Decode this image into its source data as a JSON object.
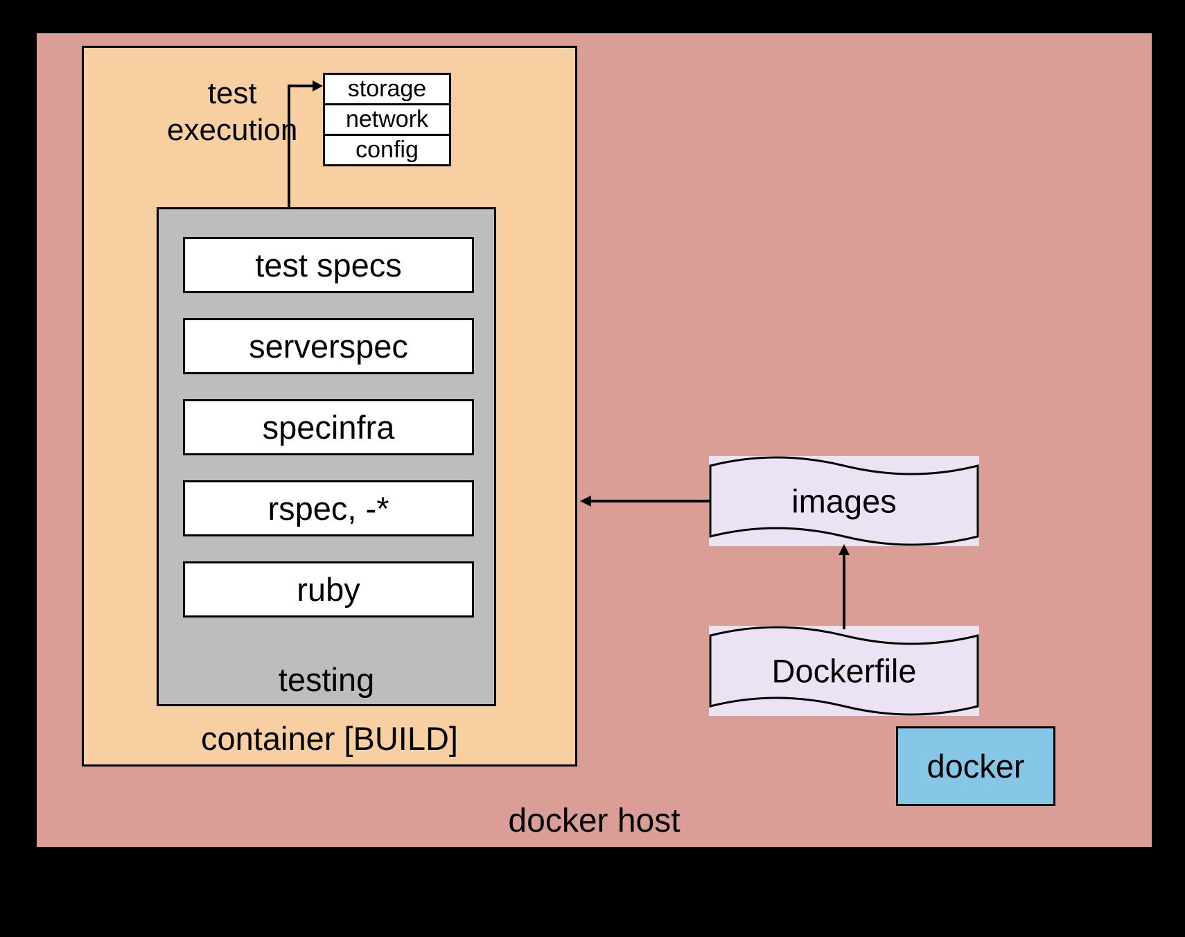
{
  "docker_host": {
    "label": "docker host"
  },
  "container_build": {
    "label": "container [BUILD]"
  },
  "test_execution": {
    "label": "test\nexecution"
  },
  "small_stack": [
    "storage",
    "network",
    "config"
  ],
  "testing": {
    "label": "testing",
    "stack": [
      "test specs",
      "serverspec",
      "specinfra",
      "rspec, -*",
      "ruby"
    ]
  },
  "images": {
    "label": "images"
  },
  "dockerfile": {
    "label": "Dockerfile"
  },
  "docker": {
    "label": "docker"
  }
}
